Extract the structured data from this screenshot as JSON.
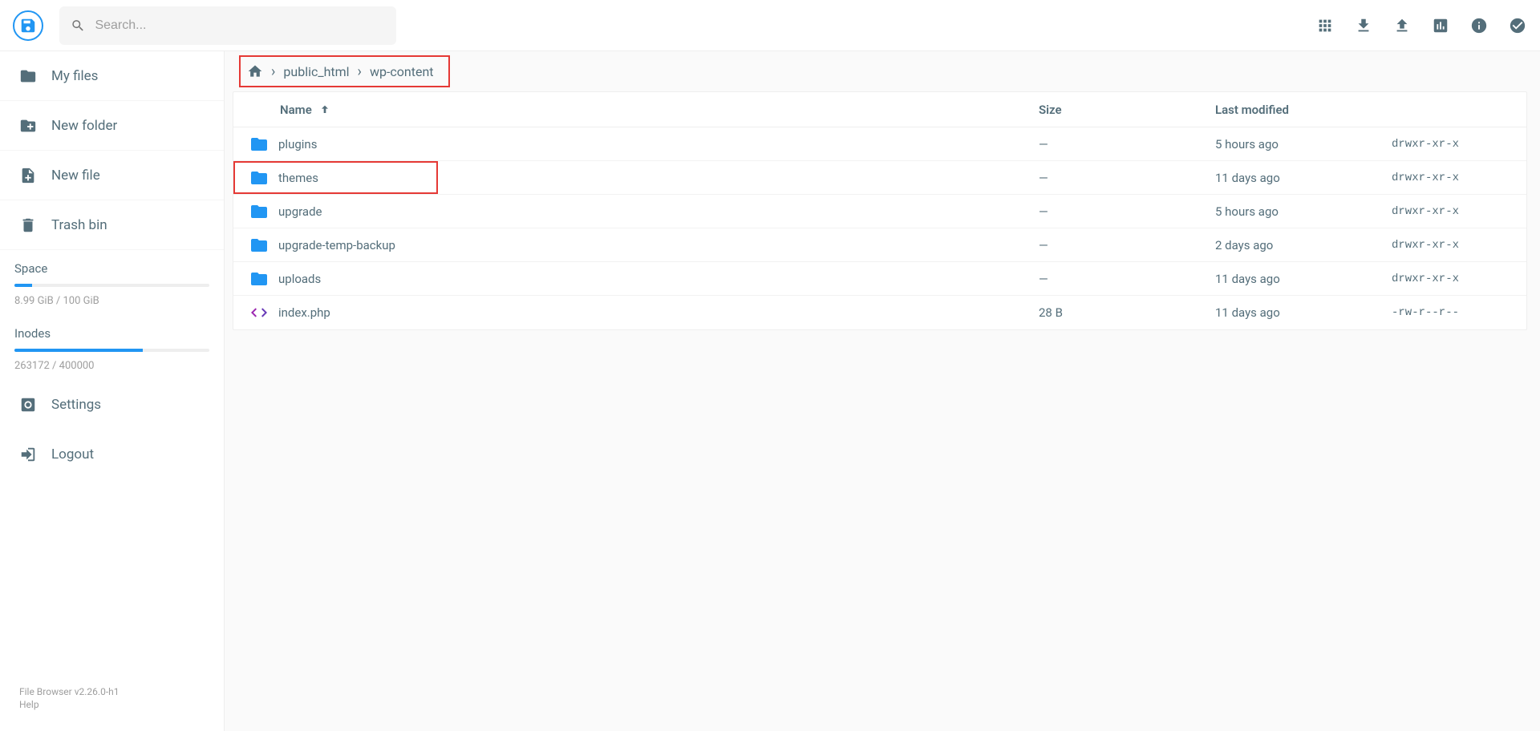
{
  "search": {
    "placeholder": "Search..."
  },
  "sidebar": {
    "myfiles": "My files",
    "newfolder": "New folder",
    "newfile": "New file",
    "trash": "Trash bin",
    "settings": "Settings",
    "logout": "Logout",
    "space_label": "Space",
    "space_text": "8.99 GiB / 100 GiB",
    "space_pct": 9,
    "inodes_label": "Inodes",
    "inodes_text": "263172 / 400000",
    "inodes_pct": 66,
    "footer_version": "File Browser v2.26.0-h1",
    "footer_help": "Help"
  },
  "breadcrumb": {
    "items": [
      "public_html",
      "wp-content"
    ]
  },
  "columns": {
    "name": "Name",
    "size": "Size",
    "modified": "Last modified"
  },
  "rows": [
    {
      "type": "folder",
      "name": "plugins",
      "size": "—",
      "modified": "5 hours ago",
      "perm": "drwxr-xr-x",
      "highlight": false
    },
    {
      "type": "folder",
      "name": "themes",
      "size": "—",
      "modified": "11 days ago",
      "perm": "drwxr-xr-x",
      "highlight": true
    },
    {
      "type": "folder",
      "name": "upgrade",
      "size": "—",
      "modified": "5 hours ago",
      "perm": "drwxr-xr-x",
      "highlight": false
    },
    {
      "type": "folder",
      "name": "upgrade-temp-backup",
      "size": "—",
      "modified": "2 days ago",
      "perm": "drwxr-xr-x",
      "highlight": false
    },
    {
      "type": "folder",
      "name": "uploads",
      "size": "—",
      "modified": "11 days ago",
      "perm": "drwxr-xr-x",
      "highlight": false
    },
    {
      "type": "code",
      "name": "index.php",
      "size": "28 B",
      "modified": "11 days ago",
      "perm": "-rw-r--r--",
      "highlight": false
    }
  ]
}
